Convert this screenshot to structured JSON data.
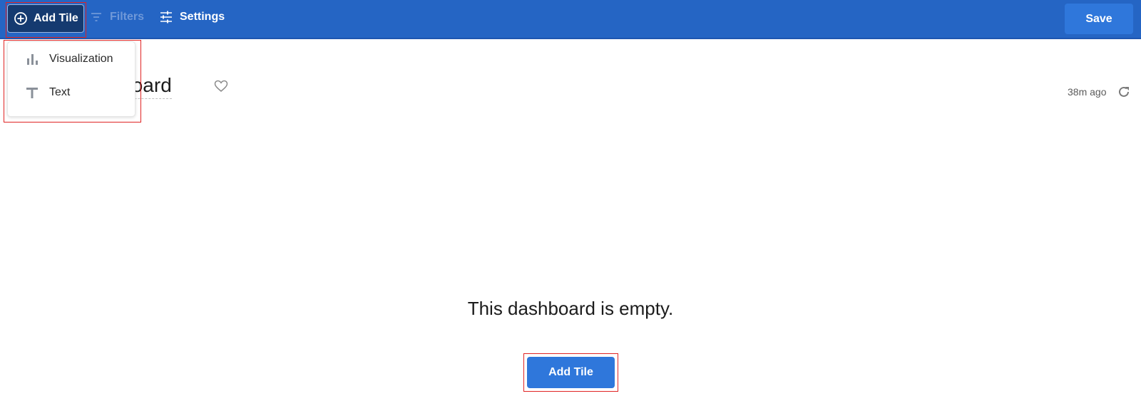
{
  "toolbar": {
    "add_tile_label": "Add Tile",
    "filters_label": "Filters",
    "settings_label": "Settings",
    "save_label": "Save"
  },
  "dashboard": {
    "title": "New Dashboard",
    "visible_title": "shboard",
    "updated_age": "38m ago"
  },
  "add_tile_menu": {
    "items": [
      {
        "label": "Visualization",
        "icon": "bar-chart-icon"
      },
      {
        "label": "Text",
        "icon": "text-icon"
      }
    ]
  },
  "empty_state": {
    "message": "This dashboard is empty.",
    "add_tile_label": "Add Tile"
  },
  "colors": {
    "topbar": "#2565c4",
    "primary_button": "#2f77db",
    "active_button": "#153a70",
    "highlight": "#e02424"
  }
}
